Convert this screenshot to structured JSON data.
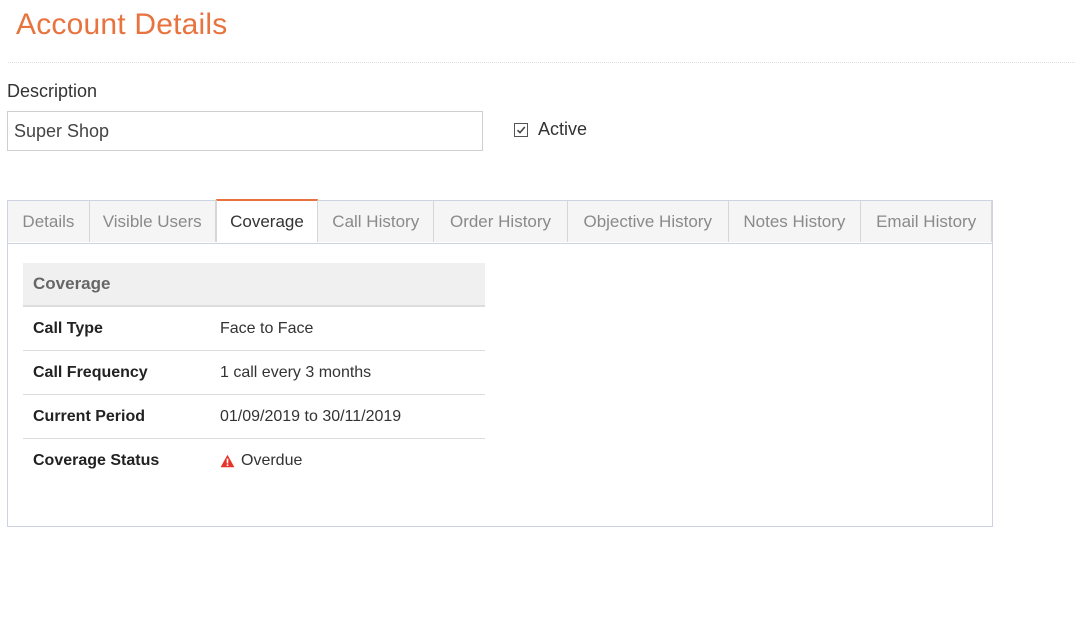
{
  "page": {
    "title": "Account Details"
  },
  "description": {
    "label": "Description",
    "value": "Super Shop",
    "placeholder": ""
  },
  "active": {
    "label": "Active",
    "checked": true
  },
  "tabs": [
    {
      "label": "Details"
    },
    {
      "label": "Visible Users"
    },
    {
      "label": "Coverage",
      "active": true
    },
    {
      "label": "Call History"
    },
    {
      "label": "Order History"
    },
    {
      "label": "Objective History"
    },
    {
      "label": "Notes History"
    },
    {
      "label": "Email History"
    }
  ],
  "coverage": {
    "header": "Coverage",
    "rows": [
      {
        "key": "Call Type",
        "value": "Face to Face"
      },
      {
        "key": "Call Frequency",
        "value": "1 call every 3 months"
      },
      {
        "key": "Current Period",
        "value": "01/09/2019 to 30/11/2019"
      },
      {
        "key": "Coverage Status",
        "value": "Overdue",
        "icon": "warning-icon",
        "icon_color": "#e8332a"
      }
    ]
  },
  "colors": {
    "accent": "#e8733e",
    "panel_border": "#cdd3e0"
  }
}
